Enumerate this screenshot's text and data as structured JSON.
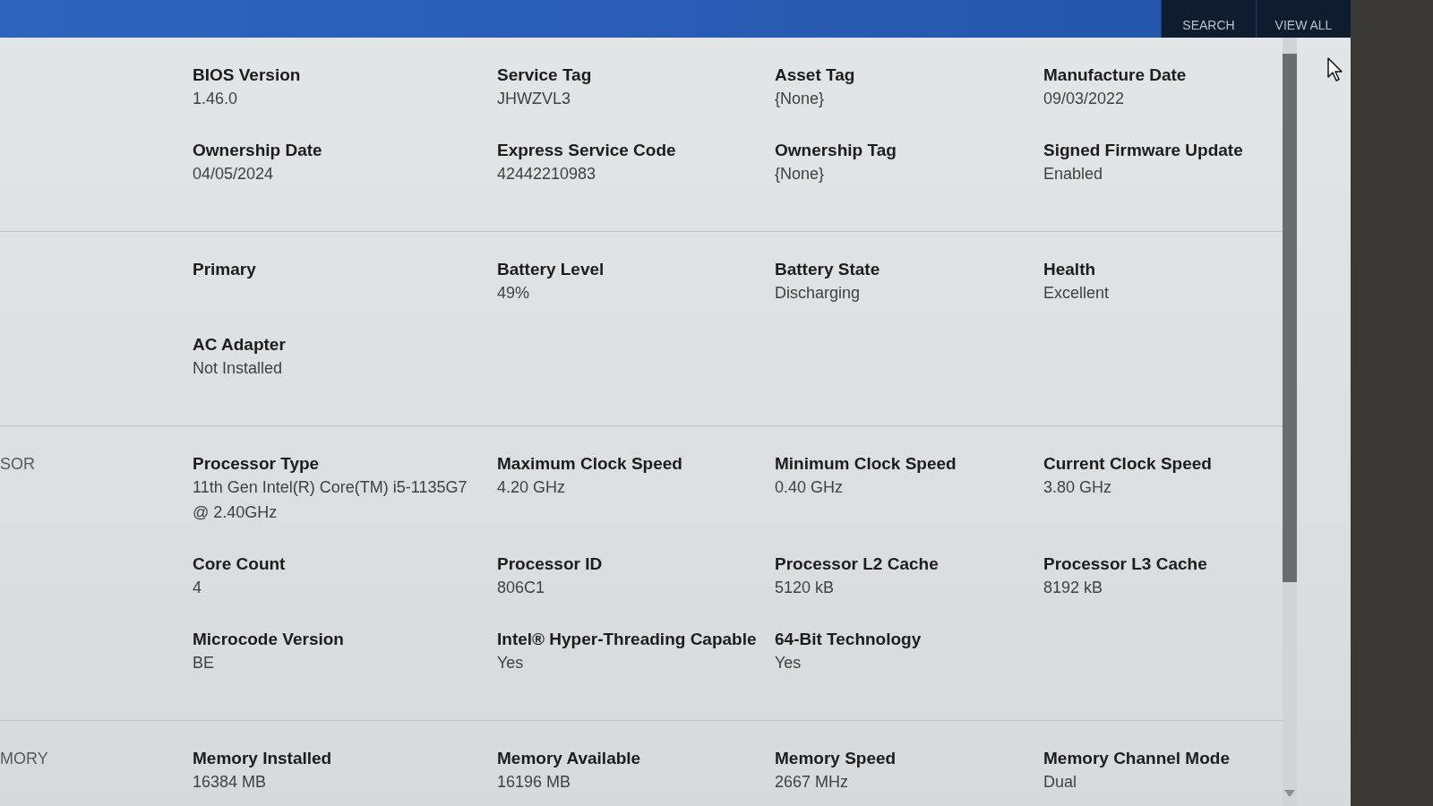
{
  "header": {
    "buttons": [
      {
        "label": "SEARCH"
      },
      {
        "label": "VIEW ALL"
      }
    ]
  },
  "sections": [
    {
      "fields": [
        {
          "label": "BIOS Version",
          "value": "1.46.0"
        },
        {
          "label": "Service Tag",
          "value": "JHWZVL3"
        },
        {
          "label": "Asset Tag",
          "value": "{None}"
        },
        {
          "label": "Manufacture Date",
          "value": "09/03/2022"
        },
        {
          "label": "Ownership Date",
          "value": "04/05/2024"
        },
        {
          "label": "Express Service Code",
          "value": "42442210983"
        },
        {
          "label": "Ownership Tag",
          "value": "{None}"
        },
        {
          "label": "Signed Firmware Update",
          "value": "Enabled"
        }
      ]
    },
    {
      "fields": [
        {
          "label": "Primary"
        },
        {
          "label": "Battery Level",
          "value": "49%"
        },
        {
          "label": "Battery State",
          "value": "Discharging"
        },
        {
          "label": "Health",
          "value": "Excellent"
        },
        {
          "label": "AC Adapter",
          "value": "Not Installed"
        }
      ]
    },
    {
      "title": "SOR",
      "fields": [
        {
          "label": "Processor Type",
          "value": "11th Gen Intel(R) Core(TM) i5-1135G7 @ 2.40GHz"
        },
        {
          "label": "Maximum Clock Speed",
          "value": "4.20 GHz"
        },
        {
          "label": "Minimum Clock Speed",
          "value": "0.40 GHz"
        },
        {
          "label": "Current Clock Speed",
          "value": "3.80 GHz"
        },
        {
          "label": "Core Count",
          "value": "4"
        },
        {
          "label": "Processor ID",
          "value": "806C1"
        },
        {
          "label": "Processor L2 Cache",
          "value": "5120 kB"
        },
        {
          "label": "Processor L3 Cache",
          "value": "8192 kB"
        },
        {
          "label": "Microcode Version",
          "value": "BE"
        },
        {
          "label": "Intel® Hyper-Threading Capable",
          "value": "Yes"
        },
        {
          "label": "64-Bit Technology",
          "value": "Yes"
        }
      ]
    },
    {
      "title": "MORY",
      "fields": [
        {
          "label": "Memory Installed",
          "value": "16384 MB"
        },
        {
          "label": "Memory Available",
          "value": "16196 MB"
        },
        {
          "label": "Memory Speed",
          "value": "2667 MHz"
        },
        {
          "label": "Memory Channel Mode",
          "value": "Dual"
        }
      ]
    }
  ]
}
